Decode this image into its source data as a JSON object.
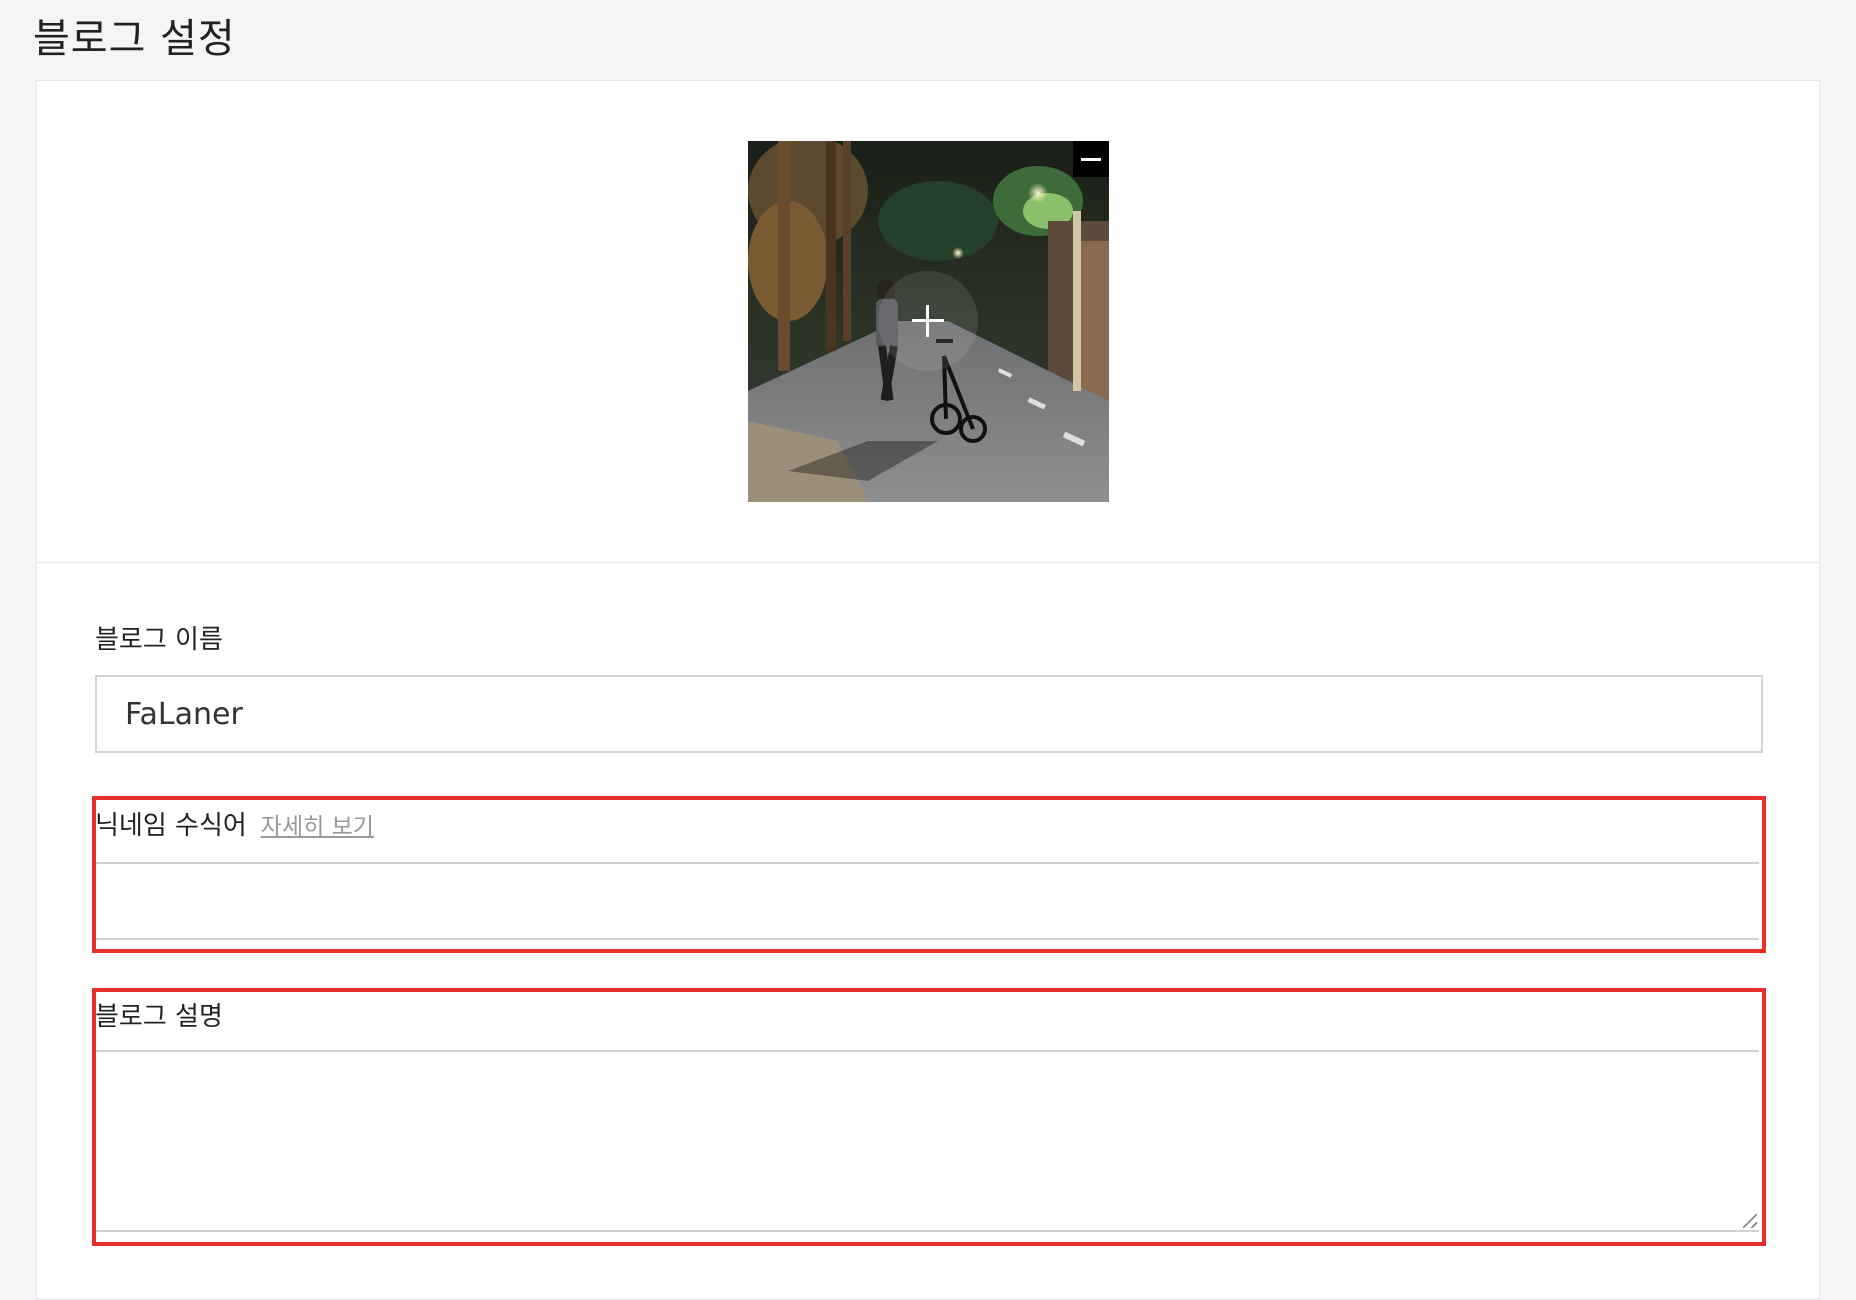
{
  "page": {
    "title": "블로그 설정"
  },
  "profile_image": {
    "remove_icon": "minus-icon",
    "add_icon": "plus-icon"
  },
  "form": {
    "blog_name": {
      "label": "블로그 이름",
      "value": "FaLaner"
    },
    "nickname_modifier": {
      "label": "닉네임 수식어",
      "detail_link": "자세히 보기",
      "value": ""
    },
    "blog_description": {
      "label": "블로그 설명",
      "value": ""
    }
  },
  "colors": {
    "highlight": "#e8302a",
    "background": "#f4f5f7",
    "border": "#cfd3da"
  }
}
